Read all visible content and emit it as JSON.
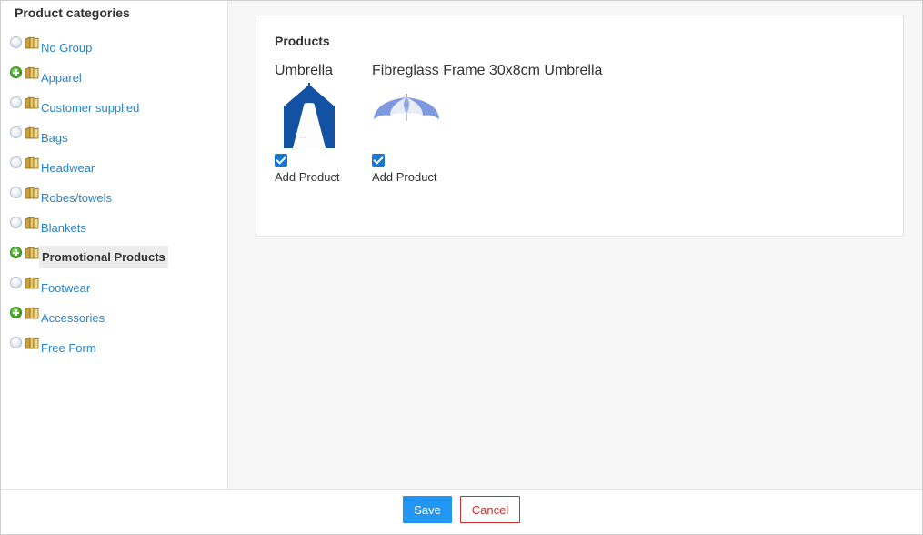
{
  "sidebar": {
    "title": "Product categories",
    "items": [
      {
        "label": "No Group",
        "expander": "leaf",
        "selected": false
      },
      {
        "label": "Apparel",
        "expander": "plus",
        "selected": false
      },
      {
        "label": "Customer supplied",
        "expander": "leaf",
        "selected": false
      },
      {
        "label": "Bags",
        "expander": "leaf",
        "selected": false
      },
      {
        "label": "Headwear",
        "expander": "leaf",
        "selected": false
      },
      {
        "label": "Robes/towels",
        "expander": "leaf",
        "selected": false
      },
      {
        "label": "Blankets",
        "expander": "leaf",
        "selected": false
      },
      {
        "label": "Promotional Products",
        "expander": "plus",
        "selected": true
      },
      {
        "label": "Footwear",
        "expander": "leaf",
        "selected": false
      },
      {
        "label": "Accessories",
        "expander": "plus",
        "selected": false
      },
      {
        "label": "Free Form",
        "expander": "leaf",
        "selected": false
      }
    ]
  },
  "products": {
    "title": "Products",
    "items": [
      {
        "name": "Umbrella",
        "add_label": "Add Product",
        "checked": true,
        "image_icon": "umbrella-image"
      },
      {
        "name": "Fibreglass Frame 30x8cm Umbrella",
        "add_label": "Add Product",
        "checked": true,
        "image_icon": "umbrella-image"
      }
    ]
  },
  "footer": {
    "save_label": "Save",
    "cancel_label": "Cancel"
  },
  "colors": {
    "link": "#2a83c7",
    "save": "#2196f3",
    "cancel": "#d32f2f",
    "checkbox": "#1976d2"
  }
}
